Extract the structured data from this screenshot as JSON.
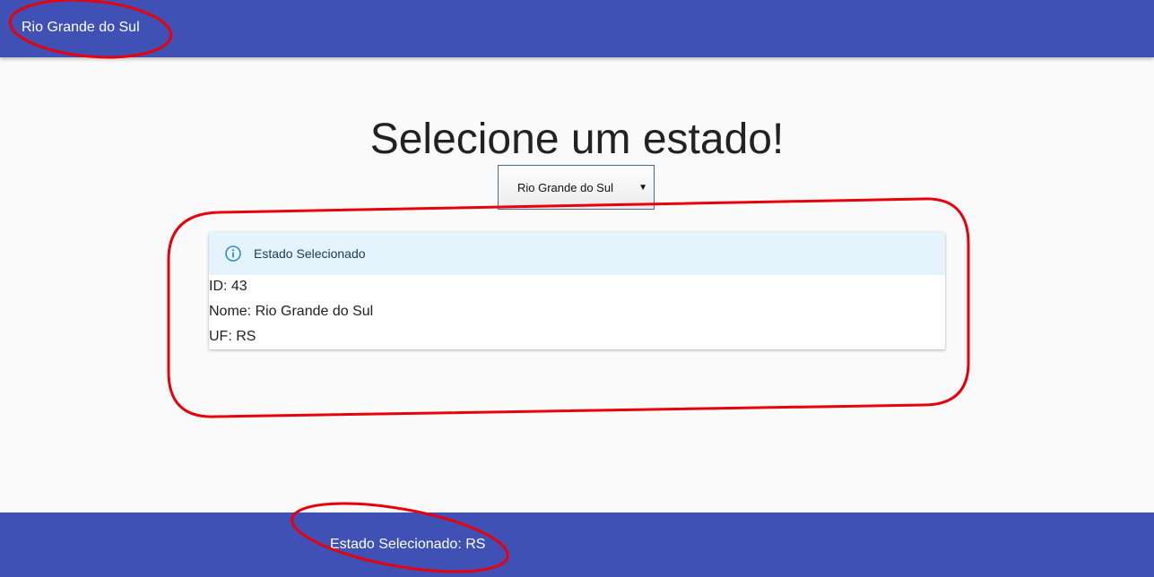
{
  "app_bar": {
    "title": "Rio Grande do Sul"
  },
  "main": {
    "heading": "Selecione um estado!",
    "state_select": {
      "selected_value": "Rio Grande do Sul",
      "arrow_icon": "triangle-down-icon"
    },
    "info_card": {
      "header_icon": "info-circle-icon",
      "header_label": "Estado Selecionado",
      "lines": [
        "ID: 43",
        "Nome: Rio Grande do Sul",
        "UF: RS"
      ]
    }
  },
  "footer": {
    "text": "Estado Selecionado: RS"
  },
  "colors": {
    "app_bar": "#3f51b5",
    "footer": "#3f51b5",
    "card_header": "#e5f3fd",
    "info_icon": "#2b8fd6",
    "annotation": "#e8000a",
    "page_background": "#fafafa"
  }
}
